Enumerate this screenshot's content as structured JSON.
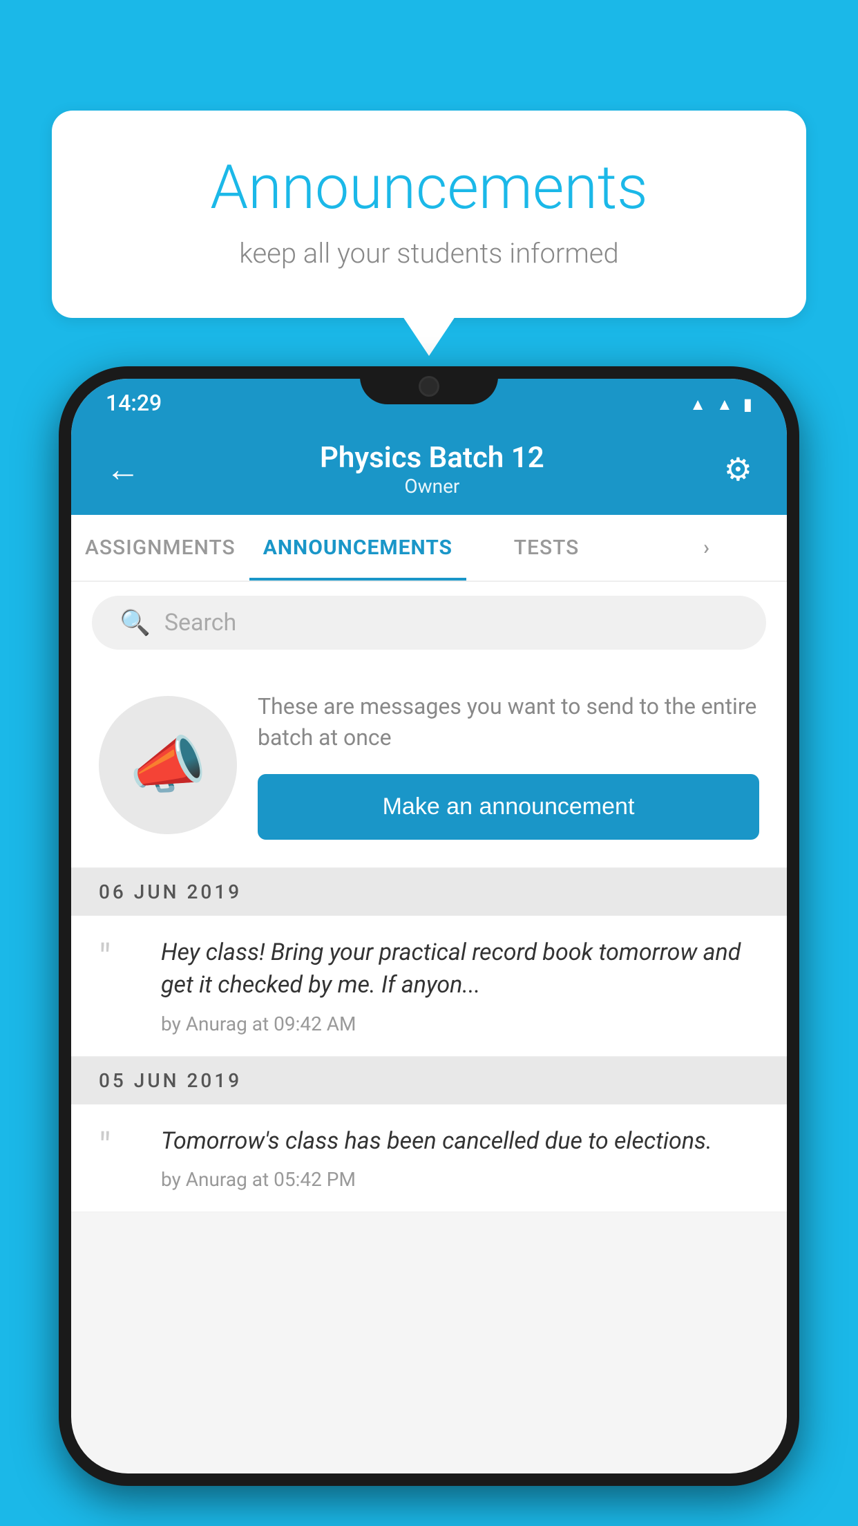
{
  "background": {
    "color": "#1BB8E8"
  },
  "speech_bubble": {
    "title": "Announcements",
    "subtitle": "keep all your students informed"
  },
  "phone": {
    "status_bar": {
      "time": "14:29",
      "wifi_icon": "wifi",
      "signal_icon": "signal",
      "battery_icon": "battery"
    },
    "header": {
      "back_icon": "←",
      "title": "Physics Batch 12",
      "subtitle": "Owner",
      "settings_icon": "⚙"
    },
    "tabs": [
      {
        "label": "ASSIGNMENTS",
        "active": false
      },
      {
        "label": "ANNOUNCEMENTS",
        "active": true
      },
      {
        "label": "TESTS",
        "active": false
      },
      {
        "label": "›",
        "active": false
      }
    ],
    "search": {
      "placeholder": "Search",
      "icon": "search"
    },
    "announcement_prompt": {
      "description": "These are messages you want to send to the entire batch at once",
      "button_label": "Make an announcement"
    },
    "announcements": [
      {
        "date": "06  JUN  2019",
        "text": "Hey class! Bring your practical record book tomorrow and get it checked by me. If anyon...",
        "meta": "by Anurag at 09:42 AM"
      },
      {
        "date": "05  JUN  2019",
        "text": "Tomorrow's class has been cancelled due to elections.",
        "meta": "by Anurag at 05:42 PM"
      }
    ]
  }
}
